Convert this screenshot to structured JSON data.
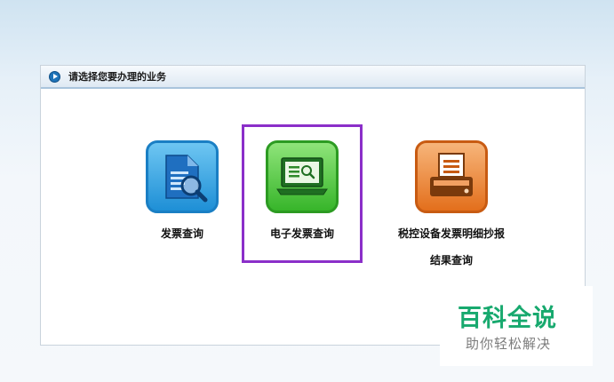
{
  "panel": {
    "header_title": "请选择您要办理的业务"
  },
  "tiles": [
    {
      "label": "发票查询",
      "icon": "document-search-icon",
      "color": "#1e8fd6"
    },
    {
      "label": "电子发票查询",
      "icon": "laptop-search-icon",
      "color": "#37b52a",
      "selected": true
    },
    {
      "label_line1": "税控设备发票明细抄报",
      "label_line2": "结果查询",
      "icon": "printer-icon",
      "color": "#e36f1c"
    }
  ],
  "colors": {
    "selection_border": "#8b2fc9",
    "watermark_green": "#17a96e"
  },
  "watermark": {
    "title": "百科全说",
    "subtitle": "助你轻松解决"
  }
}
